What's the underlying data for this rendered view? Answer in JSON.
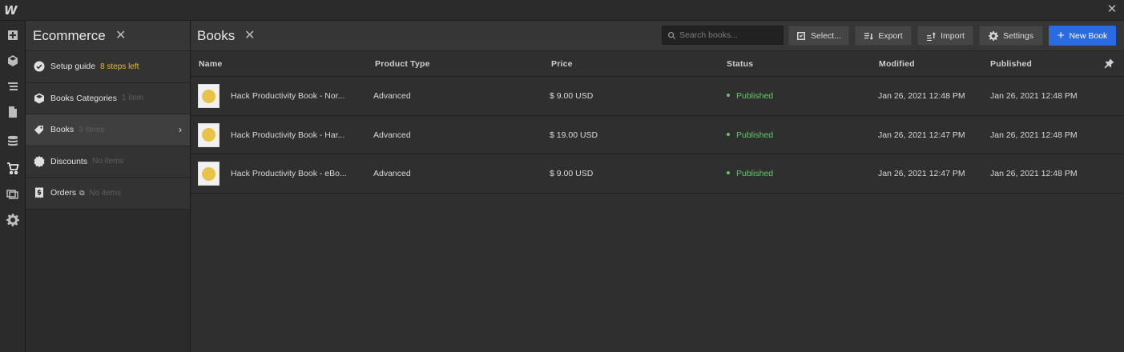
{
  "app": {
    "logo": "W",
    "close_glyph": "✕"
  },
  "rail": [
    {
      "icon": "add-panel-icon"
    },
    {
      "icon": "symbols-icon"
    },
    {
      "icon": "navigator-icon"
    },
    {
      "icon": "pages-icon"
    },
    {
      "icon": "cms-icon"
    },
    {
      "icon": "ecommerce-cart-icon",
      "active": true
    },
    {
      "icon": "assets-icon"
    },
    {
      "icon": "settings-gear-icon"
    }
  ],
  "panel": {
    "title": "Ecommerce",
    "close": "✕",
    "items": [
      {
        "label": "Setup guide",
        "sub": "8 steps left",
        "icon": "check-circle-icon"
      },
      {
        "label": "Books Categories",
        "sub": "1 item",
        "icon": "category-icon"
      },
      {
        "label": "Books",
        "sub": "3 items",
        "icon": "tag-icon",
        "arrow": "›"
      },
      {
        "label": "Discounts",
        "sub": "No items",
        "icon": "discount-badge-icon"
      },
      {
        "label": "Orders",
        "sub": "No items",
        "icon": "receipt-icon",
        "ext": "⧉"
      }
    ]
  },
  "main": {
    "title": "Books",
    "close": "✕",
    "search": {
      "placeholder": "Search books..."
    },
    "buttons": {
      "select": "Select...",
      "export": "Export",
      "import": "Import",
      "settings": "Settings",
      "new": "New Book",
      "new_plus": "+"
    },
    "columns": [
      "Name",
      "Product Type",
      "Price",
      "Status",
      "Modified",
      "Published"
    ],
    "rows": [
      {
        "name": "Hack Productivity Book - Nor...",
        "type": "Advanced",
        "price": "$ 9.00 USD",
        "status": "Published",
        "modified": "Jan 26, 2021 12:48 PM",
        "published": "Jan 26, 2021 12:48 PM"
      },
      {
        "name": "Hack Productivity Book - Har...",
        "type": "Advanced",
        "price": "$ 19.00 USD",
        "status": "Published",
        "modified": "Jan 26, 2021 12:47 PM",
        "published": "Jan 26, 2021 12:48 PM"
      },
      {
        "name": "Hack Productivity Book - eBo...",
        "type": "Advanced",
        "price": "$ 9.00 USD",
        "status": "Published",
        "modified": "Jan 26, 2021 12:47 PM",
        "published": "Jan 26, 2021 12:48 PM"
      }
    ]
  },
  "colors": {
    "accent": "#2a6be2",
    "published": "#6cc46f",
    "warning": "#e8b92c"
  }
}
